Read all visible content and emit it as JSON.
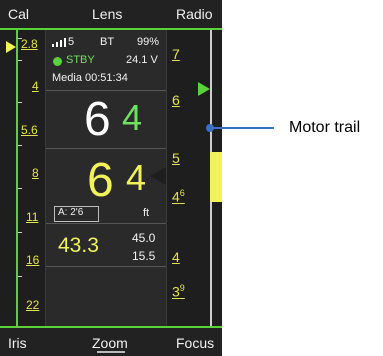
{
  "top_tabs": {
    "left": "Cal",
    "center": "Lens",
    "right": "Radio"
  },
  "bottom_tabs": {
    "left": "Iris",
    "center": "Zoom",
    "right": "Focus"
  },
  "iris_scale": [
    "2.8",
    "4",
    "5.6",
    "8",
    "11",
    "16",
    "22"
  ],
  "status": {
    "signal": "5",
    "link": "BT",
    "battery": "99%",
    "mode": "STBY",
    "voltage": "24.1 V",
    "media": "Media 00:51:34"
  },
  "iris_readout": {
    "white": "6",
    "green": "4"
  },
  "zoom_readout": {
    "white": "6",
    "yellow": "4"
  },
  "aperture": {
    "label": "A: 2'6",
    "unit": "ft"
  },
  "depth": {
    "main": "43.3",
    "far": "45.0",
    "near": "15.5"
  },
  "focus_scale": {
    "a": "7",
    "b": "6",
    "c": "5",
    "d_main": "4",
    "d_sup": "6",
    "e": "4",
    "f_main": "3",
    "f_sup": "9"
  },
  "callout": {
    "label": "Motor trail",
    "color": "#3a6fc4"
  },
  "colors": {
    "accent_green": "#5ad23a",
    "accent_yellow": "#f2f25a"
  }
}
